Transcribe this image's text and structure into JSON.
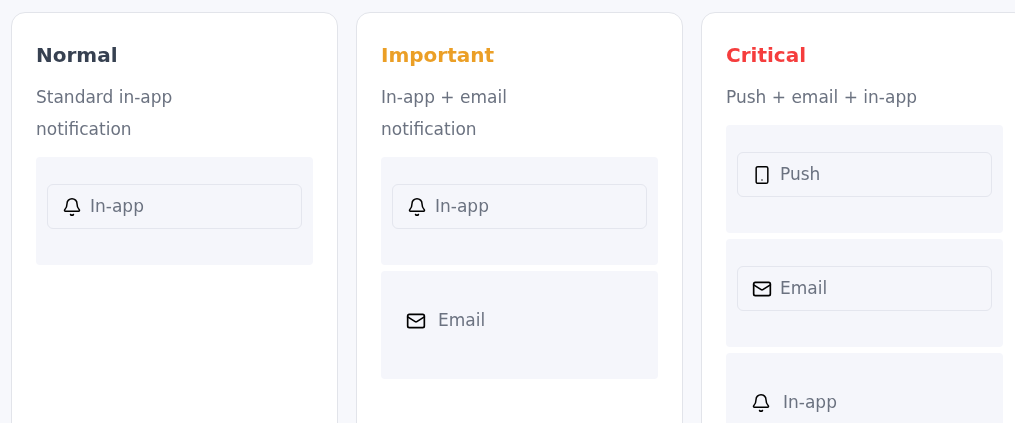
{
  "levels": [
    {
      "title": "Normal",
      "color": "#374151",
      "description": "Standard in-app notification",
      "channels": [
        {
          "kind": "bell",
          "label": "In-app",
          "framed": true
        }
      ]
    },
    {
      "title": "Important",
      "color": "#eb9f26",
      "description": "In-app + email notification",
      "channels": [
        {
          "kind": "bell",
          "label": "In-app",
          "framed": true
        },
        {
          "kind": "mail",
          "label": "Email",
          "framed": false
        }
      ]
    },
    {
      "title": "Critical",
      "color": "#f53d3d",
      "description": "Push + email + in-app",
      "channels": [
        {
          "kind": "phone",
          "label": "Push",
          "framed": true
        },
        {
          "kind": "mail",
          "label": "Email",
          "framed": true
        },
        {
          "kind": "bell",
          "label": "In-app",
          "framed": false
        }
      ]
    }
  ]
}
